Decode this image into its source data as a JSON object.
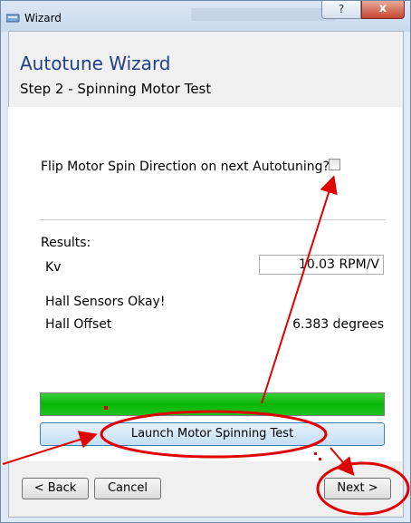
{
  "window": {
    "title": "Wizard",
    "help_glyph": "?",
    "close_glyph": "x"
  },
  "wizard": {
    "heading": "Autotune Wizard",
    "step": "Step 2 - Spinning Motor Test",
    "flip_question": "Flip Motor Spin Direction on next Autotuning?",
    "flip_checked": false,
    "results_label": "Results:",
    "kv_label": "Kv",
    "kv_value": "10.03 RPM/V",
    "hall_status": "Hall Sensors Okay!",
    "hall_offset_label": "Hall Offset",
    "hall_offset_value": "6.383 degrees",
    "progress_percent": 100,
    "launch_button": "Launch Motor Spinning Test"
  },
  "footer": {
    "back_label": "< Back",
    "cancel_label": "Cancel",
    "next_label": "Next >"
  },
  "colors": {
    "heading": "#1f3f86",
    "progress": "#08b808",
    "annotation": "#e00000"
  }
}
